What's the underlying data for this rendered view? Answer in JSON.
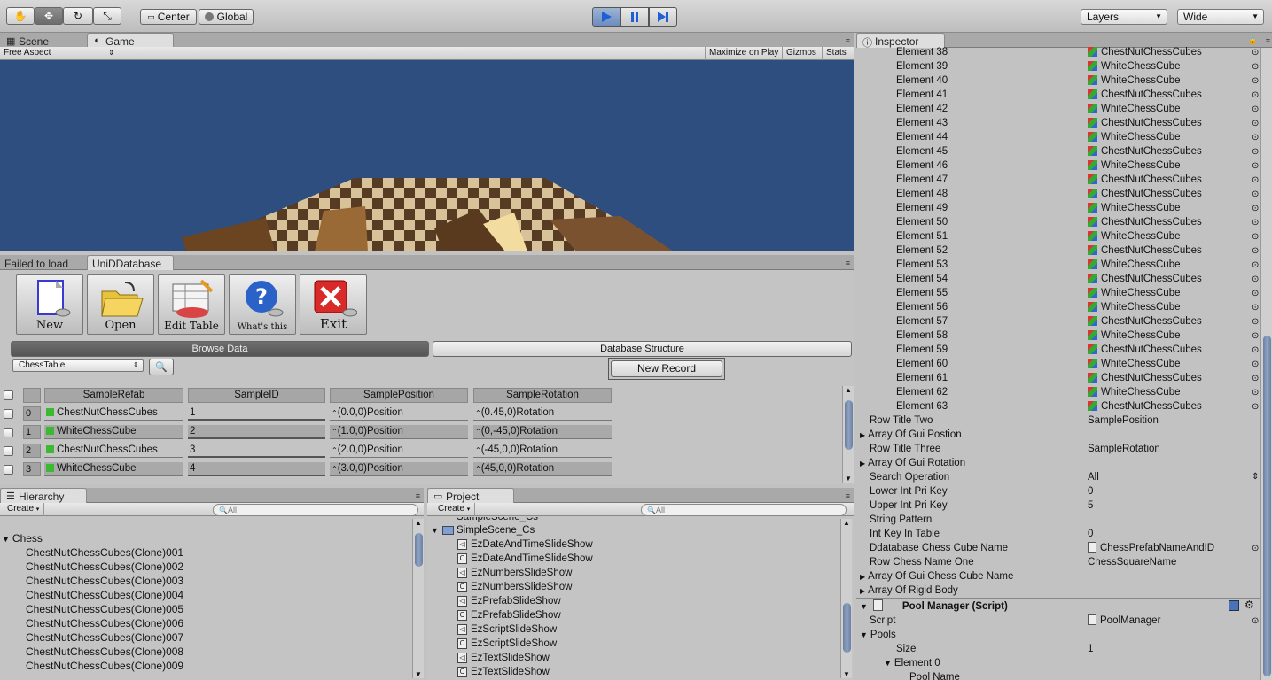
{
  "toolbar": {
    "pivot_center": "Center",
    "pivot_global": "Global",
    "layers": "Layers",
    "layout": "Wide"
  },
  "scene_panel": {
    "tab_scene": "Scene",
    "tab_game": "Game",
    "aspect": "Free Aspect",
    "maximize_on_play": "Maximize on Play",
    "gizmos": "Gizmos",
    "stats": "Stats"
  },
  "db_panel": {
    "tab_failed": "Failed to load",
    "tab_unid": "UniDDatabase",
    "buttons": [
      "New",
      "Open",
      "Edit Table",
      "What's this",
      "Exit"
    ],
    "browse_data": "Browse Data",
    "database_structure": "Database Structure",
    "table_select": "ChessTable",
    "new_record": "New Record",
    "columns": [
      "SampleRefab",
      "SampleID",
      "SamplePosition",
      "SampleRotation"
    ],
    "rows": [
      {
        "idx": "0",
        "prefab": "ChestNutChessCubes",
        "id": "1",
        "pos": "(0.0,0)Position",
        "rot": "(0.45,0)Rotation"
      },
      {
        "idx": "1",
        "prefab": "WhiteChessCube",
        "id": "2",
        "pos": "(1.0,0)Position",
        "rot": "(0,-45,0)Rotation"
      },
      {
        "idx": "2",
        "prefab": "ChestNutChessCubes",
        "id": "3",
        "pos": "(2.0,0)Position",
        "rot": "(-45,0,0)Rotation"
      },
      {
        "idx": "3",
        "prefab": "WhiteChessCube",
        "id": "4",
        "pos": "(3.0,0)Position",
        "rot": "(45,0,0)Rotation"
      }
    ]
  },
  "hierarchy": {
    "tab": "Hierarchy",
    "create": "Create",
    "search_placeholder": "All",
    "root": "Chess",
    "items": [
      "ChestNutChessCubes(Clone)001",
      "ChestNutChessCubes(Clone)002",
      "ChestNutChessCubes(Clone)003",
      "ChestNutChessCubes(Clone)004",
      "ChestNutChessCubes(Clone)005",
      "ChestNutChessCubes(Clone)006",
      "ChestNutChessCubes(Clone)007",
      "ChestNutChessCubes(Clone)008",
      "ChestNutChessCubes(Clone)009"
    ]
  },
  "project": {
    "tab": "Project",
    "create": "Create",
    "search_placeholder": "All",
    "folder_cut": "SampleScene_Cs",
    "folder": "SimpleScene_Cs",
    "items": [
      "EzDateAndTimeSlideShow",
      "EzDateAndTimeSlideShow",
      "EzNumbersSlideShow",
      "EzNumbersSlideShow",
      "EzPrefabSlideShow",
      "EzPrefabSlideShow",
      "EzScriptSlideShow",
      "EzScriptSlideShow",
      "EzTextSlideShow",
      "EzTextSlideShow"
    ]
  },
  "inspector": {
    "tab": "Inspector",
    "elements": [
      {
        "label": "Element 38",
        "value": "ChestNutChessCubes"
      },
      {
        "label": "Element 39",
        "value": "WhiteChessCube"
      },
      {
        "label": "Element 40",
        "value": "WhiteChessCube"
      },
      {
        "label": "Element 41",
        "value": "ChestNutChessCubes"
      },
      {
        "label": "Element 42",
        "value": "WhiteChessCube"
      },
      {
        "label": "Element 43",
        "value": "ChestNutChessCubes"
      },
      {
        "label": "Element 44",
        "value": "WhiteChessCube"
      },
      {
        "label": "Element 45",
        "value": "ChestNutChessCubes"
      },
      {
        "label": "Element 46",
        "value": "WhiteChessCube"
      },
      {
        "label": "Element 47",
        "value": "ChestNutChessCubes"
      },
      {
        "label": "Element 48",
        "value": "ChestNutChessCubes"
      },
      {
        "label": "Element 49",
        "value": "WhiteChessCube"
      },
      {
        "label": "Element 50",
        "value": "ChestNutChessCubes"
      },
      {
        "label": "Element 51",
        "value": "WhiteChessCube"
      },
      {
        "label": "Element 52",
        "value": "ChestNutChessCubes"
      },
      {
        "label": "Element 53",
        "value": "WhiteChessCube"
      },
      {
        "label": "Element 54",
        "value": "ChestNutChessCubes"
      },
      {
        "label": "Element 55",
        "value": "WhiteChessCube"
      },
      {
        "label": "Element 56",
        "value": "WhiteChessCube"
      },
      {
        "label": "Element 57",
        "value": "ChestNutChessCubes"
      },
      {
        "label": "Element 58",
        "value": "WhiteChessCube"
      },
      {
        "label": "Element 59",
        "value": "ChestNutChessCubes"
      },
      {
        "label": "Element 60",
        "value": "WhiteChessCube"
      },
      {
        "label": "Element 61",
        "value": "ChestNutChessCubes"
      },
      {
        "label": "Element 62",
        "value": "WhiteChessCube"
      },
      {
        "label": "Element 63",
        "value": "ChestNutChessCubes"
      }
    ],
    "props": [
      {
        "label": "Row Title Two",
        "value": "SamplePosition",
        "fold": false
      },
      {
        "label": "Array Of Gui Postion",
        "value": "",
        "fold": true
      },
      {
        "label": "Row Title Three",
        "value": "SampleRotation",
        "fold": false
      },
      {
        "label": "Array Of Gui Rotation",
        "value": "",
        "fold": true
      },
      {
        "label": "Search Operation",
        "value": "All",
        "fold": false
      },
      {
        "label": "Lower Int Pri Key",
        "value": "0",
        "fold": false
      },
      {
        "label": "Upper Int Pri Key",
        "value": "5",
        "fold": false
      },
      {
        "label": "String Pattern",
        "value": "",
        "fold": false
      },
      {
        "label": "Int Key In Table",
        "value": "0",
        "fold": false
      },
      {
        "label": "Ddatabase Chess Cube Name",
        "value": "ChessPrefabNameAndID",
        "fold": false
      },
      {
        "label": "Row Chess Name One",
        "value": "ChessSquareName",
        "fold": false
      },
      {
        "label": "Array Of Gui Chess Cube Name",
        "value": "",
        "fold": true
      },
      {
        "label": "Array Of Rigid Body",
        "value": "",
        "fold": true
      }
    ],
    "component": "Pool Manager (Script)",
    "script_label": "Script",
    "script_value": "PoolManager",
    "pools": "Pools",
    "size_label": "Size",
    "size_value": "1",
    "element0": "Element 0",
    "pool_name": "Pool Name"
  }
}
